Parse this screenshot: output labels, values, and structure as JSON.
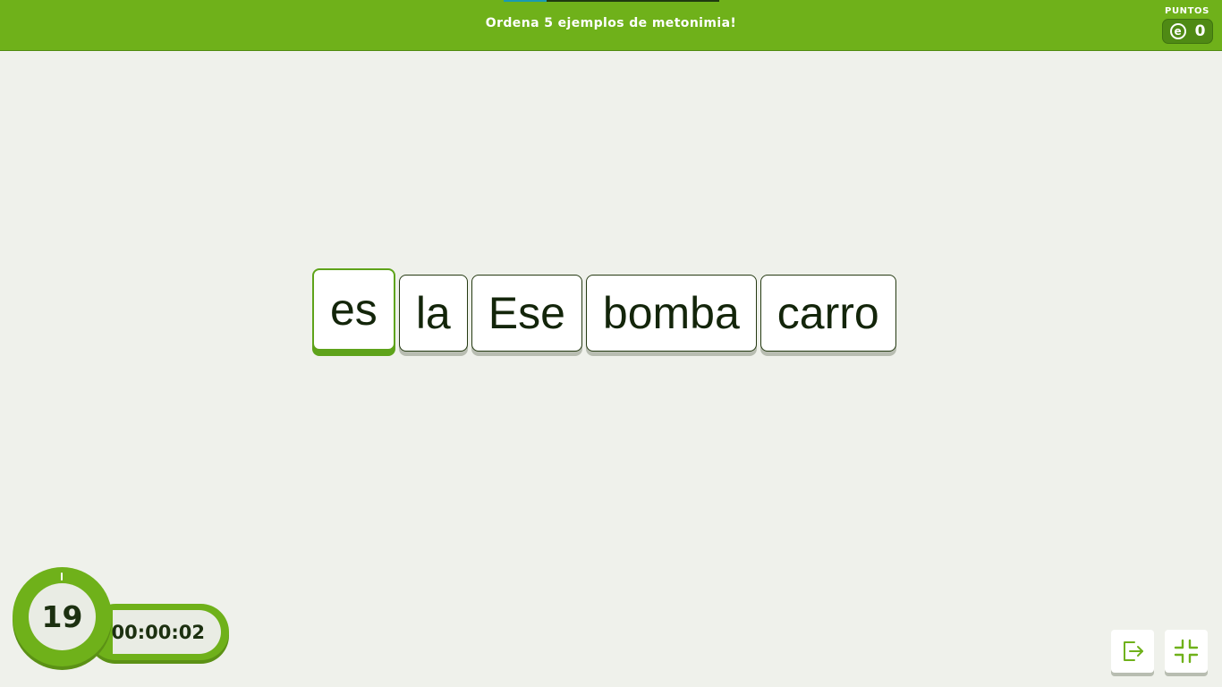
{
  "header": {
    "title": "Ordena 5 ejemplos de metonimia!",
    "progress": 0.2,
    "points_label": "PUNTOS",
    "points_value": "0",
    "coin_symbol": "e",
    "accent_color": "#6fb11a",
    "progress_color": "#1a9bb0"
  },
  "tiles": [
    {
      "word": "es",
      "selected": true
    },
    {
      "word": "la",
      "selected": false
    },
    {
      "word": "Ese",
      "selected": false
    },
    {
      "word": "bomba",
      "selected": false
    },
    {
      "word": "carro",
      "selected": false
    }
  ],
  "timer": {
    "countdown": "19",
    "elapsed": "00:00:02"
  },
  "buttons": {
    "exit_icon": "exit-icon",
    "fullscreen_icon": "exit-fullscreen-icon"
  }
}
